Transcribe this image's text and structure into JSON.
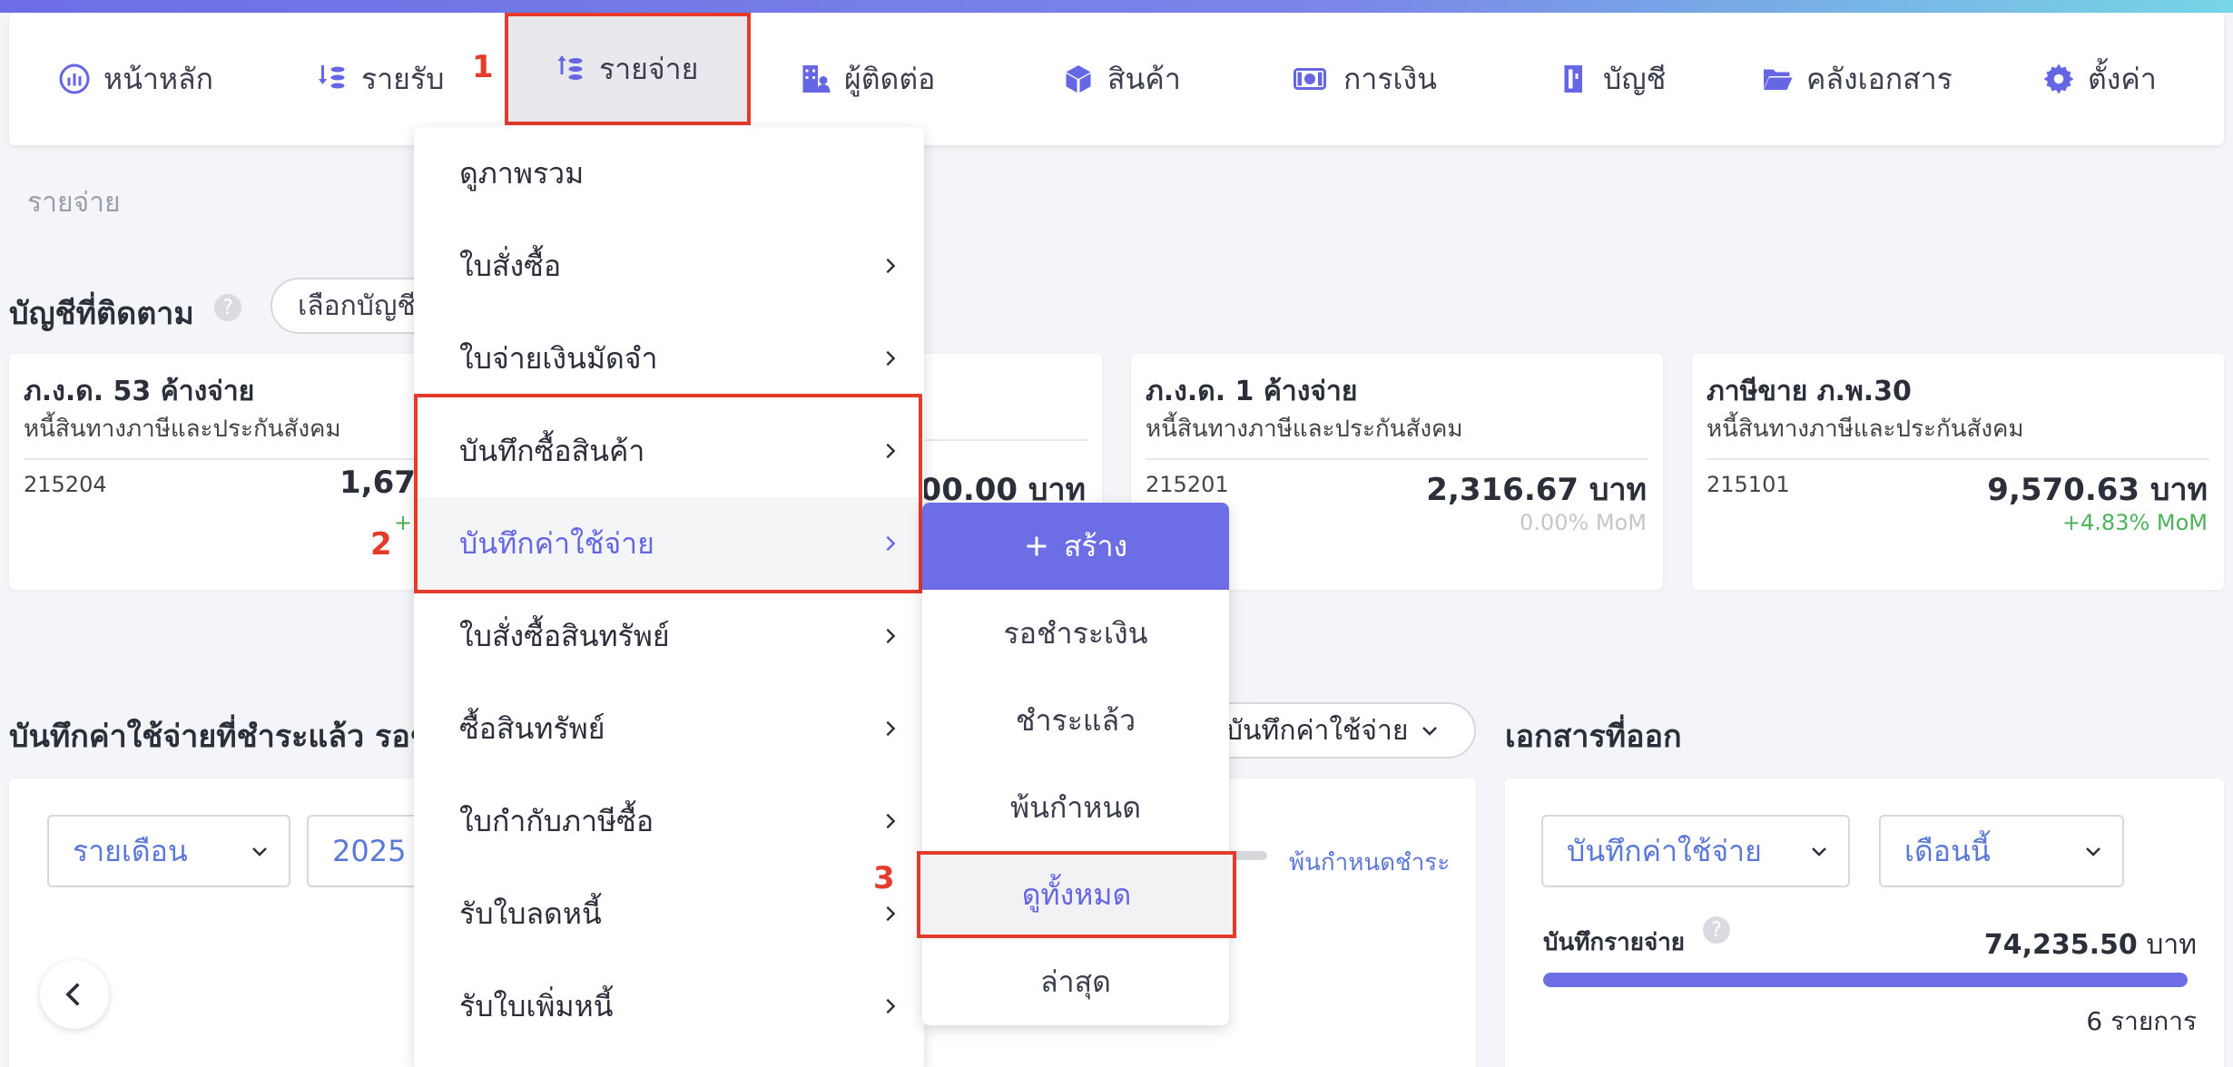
{
  "nav": {
    "items": [
      {
        "label": "หน้าหลัก",
        "icon": "chart-icon"
      },
      {
        "label": "รายรับ",
        "icon": "coins-down-icon"
      },
      {
        "label": "รายจ่าย",
        "icon": "coins-up-icon",
        "active": true
      },
      {
        "label": "ผู้ติดต่อ",
        "icon": "building-user-icon"
      },
      {
        "label": "สินค้า",
        "icon": "box-icon"
      },
      {
        "label": "การเงิน",
        "icon": "money-icon"
      },
      {
        "label": "บัญชี",
        "icon": "book-icon"
      },
      {
        "label": "คลังเอกสาร",
        "icon": "folder-icon"
      },
      {
        "label": "ตั้งค่า",
        "icon": "gear-icon"
      }
    ]
  },
  "steps": {
    "one": "1",
    "two": "2",
    "three": "3"
  },
  "breadcrumb": "รายจ่าย",
  "tracked": {
    "title": "บัญชีที่ติดตาม",
    "help": "?",
    "select_label": "เลือกบัญชี",
    "cards": [
      {
        "title": "ภ.ง.ด. 53 ค้างจ่าย",
        "sub": "หนี้สินทางภาษีและประกันสังคม",
        "code": "215204",
        "amount": "1,678",
        "mom": "+"
      },
      {
        "title": "",
        "sub": "",
        "code": "",
        "amount": "200.00 บาท",
        "mom": ""
      },
      {
        "title": "ภ.ง.ด. 1 ค้างจ่าย",
        "sub": "หนี้สินทางภาษีและประกันสังคม",
        "code": "215201",
        "amount": "2,316.67 บาท",
        "mom": "0.00% MoM"
      },
      {
        "title": "ภาษีขาย ภ.พ.30",
        "sub": "หนี้สินทางภาษีและประกันสังคม",
        "code": "215101",
        "amount": "9,570.63 บาท",
        "mom": "+4.83% MoM"
      }
    ]
  },
  "expenses_section": {
    "title": "บันทึกค่าใช้จ่ายที่ชำระแล้ว รอชำ",
    "filter_period": "รายเดือน",
    "filter_year": "2025",
    "type_select": "บันทึกค่าใช้จ่าย",
    "overdue_label": "พ้นกำหนดชำระ"
  },
  "issued_docs": {
    "title": "เอกสารที่ออก",
    "type_select": "บันทึกค่าใช้จ่าย",
    "period_select": "เดือนนี้",
    "row_label": "บันทึกรายจ่าย",
    "help": "?",
    "amount": "74,235.50",
    "unit": "บาท",
    "count": "6 รายการ",
    "progress": 1.0
  },
  "menu": {
    "items": [
      {
        "label": "ดูภาพรวม",
        "arrow": false
      },
      {
        "label": "ใบสั่งซื้อ",
        "arrow": true
      },
      {
        "label": "ใบจ่ายเงินมัดจำ",
        "arrow": true
      },
      {
        "label": "บันทึกซื้อสินค้า",
        "arrow": true
      },
      {
        "label": "บันทึกค่าใช้จ่าย",
        "arrow": true,
        "hover": true
      },
      {
        "label": "ใบสั่งซื้อสินทรัพย์",
        "arrow": true
      },
      {
        "label": "ซื้อสินทรัพย์",
        "arrow": true
      },
      {
        "label": "ใบกำกับภาษีซื้อ",
        "arrow": true
      },
      {
        "label": "รับใบลดหนี้",
        "arrow": true
      },
      {
        "label": "รับใบเพิ่มหนี้",
        "arrow": true
      }
    ]
  },
  "submenu": {
    "create_label": "สร้าง",
    "items": [
      "รอชำระเงิน",
      "ชำระแล้ว",
      "พ้นกำหนด",
      "ดูทั้งหมด",
      "ล่าสุด"
    ]
  },
  "colors": {
    "accent": "#6d6ee6",
    "highlight": "#e43b2c",
    "positive": "#4cb35a",
    "link": "#5b78d8"
  }
}
